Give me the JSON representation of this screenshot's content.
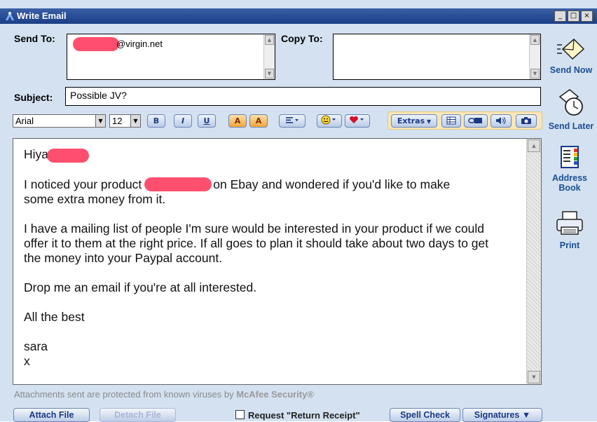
{
  "window": {
    "title": "Write Email",
    "controls": [
      "_",
      "□",
      "×"
    ]
  },
  "fields": {
    "send_to_label": "Send To:",
    "send_to_value": "@virgin.net",
    "copy_to_label": "Copy To:",
    "copy_to_value": "",
    "subject_label": "Subject:",
    "subject_value": "Possible JV?"
  },
  "toolbar": {
    "font": "Arial",
    "size": "12",
    "bold": "B",
    "italic": "I",
    "underline": "U",
    "text_color": "A",
    "highlight": "A",
    "extras": "Extras"
  },
  "message": {
    "greeting": "Hiya",
    "p1a": "I noticed your product",
    "p1b": "on Ebay and wondered if you'd like to make",
    "p1c": "some extra money from it.",
    "p2": "I have a mailing list of people I'm sure would be interested in your product if we could offer it to them at the right price. If all goes to plan it should take about two days to get the money into your Paypal account.",
    "p3": "Drop me an email if you're at all interested.",
    "p4": "All the best",
    "sig1": "sara",
    "sig2": "x"
  },
  "footer": {
    "security_note": "Attachments sent are protected from known viruses by",
    "security_brand": "McAfee Security®",
    "attach_file": "Attach File",
    "detach_file": "Detach File",
    "return_receipt": "Request \"Return Receipt\"",
    "spell_check": "Spell Check",
    "signatures": "Signatures ▼"
  },
  "side_actions": {
    "send_now": "Send Now",
    "send_later": "Send Later",
    "address_book_1": "Address",
    "address_book_2": "Book",
    "print": "Print"
  },
  "colors": {
    "titlebar": "#1b3e86",
    "panel": "#d3e1f1",
    "redaction": "#ff4f6e",
    "link_blue": "#1b4f93"
  }
}
